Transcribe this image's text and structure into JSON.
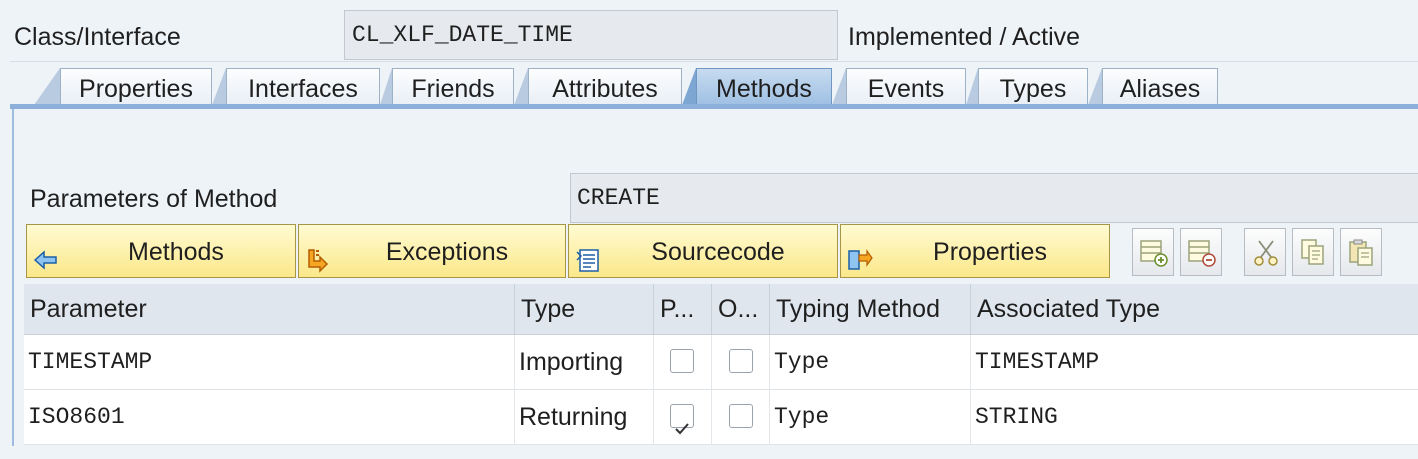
{
  "header": {
    "class_label": "Class/Interface",
    "class_value": "CL_XLF_DATE_TIME",
    "status": "Implemented / Active"
  },
  "tabs": [
    {
      "label": "Properties"
    },
    {
      "label": "Interfaces"
    },
    {
      "label": "Friends"
    },
    {
      "label": "Attributes"
    },
    {
      "label": "Methods",
      "active": true
    },
    {
      "label": "Events"
    },
    {
      "label": "Types"
    },
    {
      "label": "Aliases"
    }
  ],
  "method": {
    "label": "Parameters of Method",
    "value": "CREATE"
  },
  "toolbar": {
    "methods": "Methods",
    "exceptions": "Exceptions",
    "sourcecode": "Sourcecode",
    "properties": "Properties",
    "icons": [
      "insert-row-icon",
      "delete-row-icon",
      "cut-icon",
      "copy-icon",
      "paste-icon"
    ]
  },
  "table": {
    "headers": [
      "Parameter",
      "Type",
      "P...",
      "O...",
      "Typing Method",
      "Associated Type"
    ],
    "rows": [
      {
        "parameter": "TIMESTAMP",
        "type": "Importing",
        "pass_by_value": false,
        "optional": false,
        "typing": "Type",
        "assoc": "TIMESTAMP"
      },
      {
        "parameter": "ISO8601",
        "type": "Returning",
        "pass_by_value": true,
        "optional": false,
        "typing": "Type",
        "assoc": "STRING"
      }
    ]
  },
  "colors": {
    "active_tab": "#9fc0e3",
    "button_yellow": "#fbe88a",
    "background": "#eef3f8"
  }
}
